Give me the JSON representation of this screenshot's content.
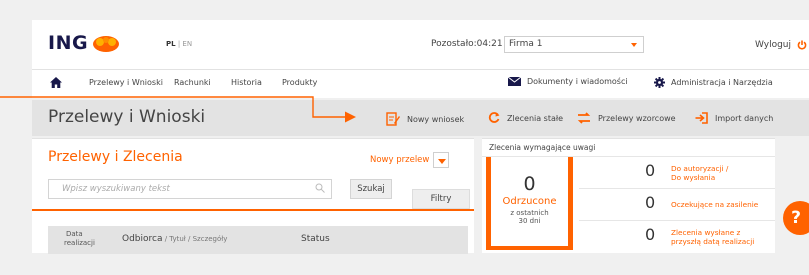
{
  "header": {
    "logo_text": "ING",
    "lang_active": "PL",
    "lang_separator": " | ",
    "lang_other": "EN",
    "timer_label": "Pozostało:04:21",
    "firm_selected": "Firma 1",
    "logout_label": "Wyloguj"
  },
  "nav": {
    "items": [
      "Przelewy i Wnioski",
      "Rachunki",
      "Historia",
      "Produkty"
    ],
    "documents_label": "Dokumenty i wiadomości",
    "admin_label": "Administracja i Narzędzia"
  },
  "titlebar": {
    "title": "Przelewy i Wnioski",
    "actions": [
      "Nowy wniosek",
      "Zlecenia stałe",
      "Przelewy wzorcowe",
      "Import danych"
    ]
  },
  "transfers": {
    "title": "Przelewy i Zlecenia",
    "new_transfer_label": "Nowy przelew",
    "search_placeholder": "Wpisz wyszukiwany tekst",
    "search_button": "Szukaj",
    "filters_button": "Filtry",
    "columns": {
      "date_line1": "Data",
      "date_line2": "realizacji",
      "recipient_main": "Odbiorca",
      "recipient_sub": " / Tytuł / Szczegóły",
      "status": "Status"
    }
  },
  "attention": {
    "header": "Zlecenia wymagające uwagi",
    "rejected": {
      "count": "0",
      "label": "Odrzucone",
      "sub_line1": "z ostatnich",
      "sub_line2": "30 dni"
    },
    "items": [
      {
        "count": "0",
        "line1": "Do autoryzacji /",
        "line2": "Do wysłania"
      },
      {
        "count": "0",
        "line1": "Oczekujące na zasilenie",
        "line2": ""
      },
      {
        "count": "0",
        "line1": "Zlecenia wysłane z",
        "line2": "przyszłą datą realizacji"
      }
    ]
  },
  "help": {
    "label": "?"
  },
  "colors": {
    "accent": "#ff6200",
    "navy": "#18184a",
    "panel_grey": "#e3e3e3"
  },
  "icons": [
    "lion-icon",
    "power-icon",
    "home-icon",
    "envelope-icon",
    "gear-icon",
    "document-edit-icon",
    "refresh-icon",
    "exchange-icon",
    "import-icon",
    "search-icon",
    "chevron-down-icon"
  ]
}
